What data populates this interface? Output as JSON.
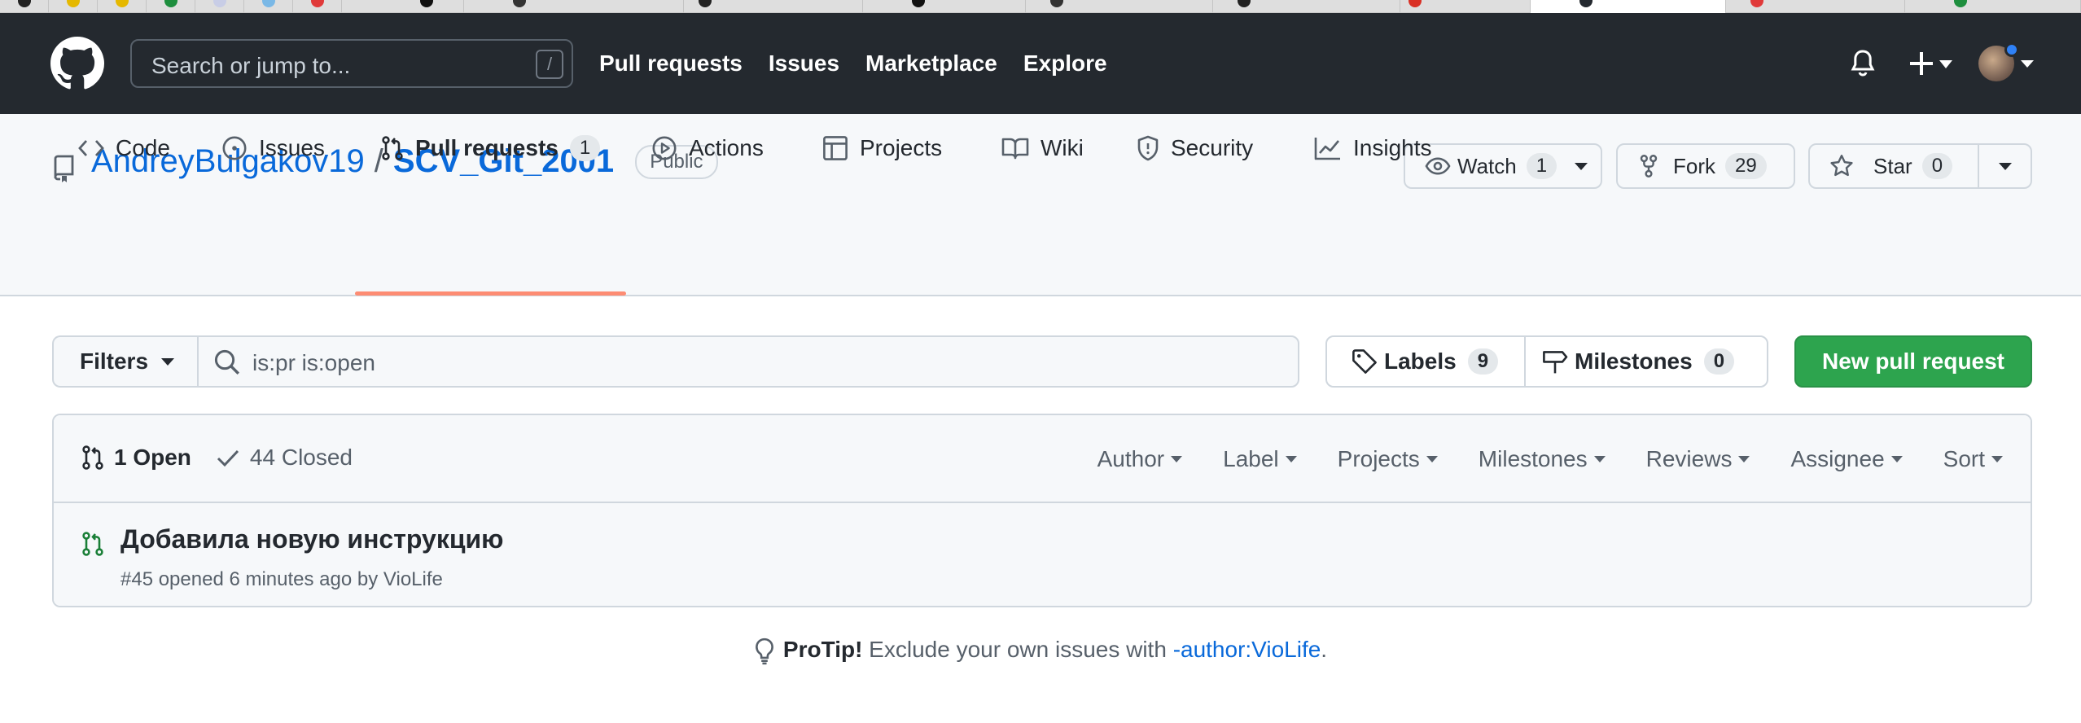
{
  "header": {
    "search_placeholder": "Search or jump to...",
    "search_shortcut": "/",
    "nav": [
      "Pull requests",
      "Issues",
      "Marketplace",
      "Explore"
    ]
  },
  "repo": {
    "owner": "AndreyBulgakov19",
    "separator": "/",
    "name": "SCV_Git_2001",
    "visibility": "Public",
    "watch_label": "Watch",
    "watch_count": "1",
    "fork_label": "Fork",
    "fork_count": "29",
    "star_label": "Star",
    "star_count": "0"
  },
  "tabs": [
    {
      "label": "Code",
      "icon": "code-icon"
    },
    {
      "label": "Issues",
      "icon": "issue-icon"
    },
    {
      "label": "Pull requests",
      "icon": "pull-request-icon",
      "count": "1",
      "selected": true
    },
    {
      "label": "Actions",
      "icon": "play-icon"
    },
    {
      "label": "Projects",
      "icon": "table-icon"
    },
    {
      "label": "Wiki",
      "icon": "book-icon"
    },
    {
      "label": "Security",
      "icon": "shield-icon"
    },
    {
      "label": "Insights",
      "icon": "graph-icon"
    }
  ],
  "toolbar": {
    "filters_label": "Filters",
    "query": "is:pr is:open",
    "labels_label": "Labels",
    "labels_count": "9",
    "milestones_label": "Milestones",
    "milestones_count": "0",
    "new_pr_label": "New pull request"
  },
  "list": {
    "open_label": "1 Open",
    "closed_label": "44 Closed",
    "sort_menus": [
      "Author",
      "Label",
      "Projects",
      "Milestones",
      "Reviews",
      "Assignee",
      "Sort"
    ],
    "items": [
      {
        "title": "Добавила новую инструкцию",
        "meta": "#45 opened 6 minutes ago by VioLife"
      }
    ]
  },
  "protip": {
    "lead": "ProTip!",
    "text": " Exclude your own issues with ",
    "link": "-author:VioLife",
    "end": "."
  },
  "colors": {
    "header_bg": "#24292f",
    "link_blue": "#0969da",
    "green_button": "#2da44e",
    "open_green": "#1a7f37",
    "tab_underline": "#fd8c73"
  }
}
